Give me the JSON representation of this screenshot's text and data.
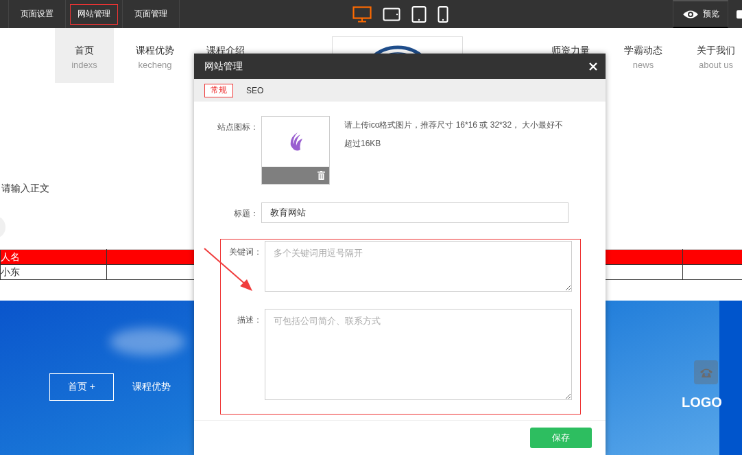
{
  "toolbar": {
    "tabs": [
      {
        "label": "页面设置",
        "selected": false
      },
      {
        "label": "网站管理",
        "selected": true
      },
      {
        "label": "页面管理",
        "selected": false
      }
    ],
    "devices": [
      {
        "kind": "desktop",
        "selected": true
      },
      {
        "kind": "tablet-landscape",
        "selected": false
      },
      {
        "kind": "tablet",
        "selected": false
      },
      {
        "kind": "phone",
        "selected": false
      }
    ],
    "preview_label": "预览"
  },
  "site_nav": {
    "items": [
      {
        "label": "首页",
        "sub": "indexs",
        "selected": true
      },
      {
        "label": "课程优势",
        "sub": "kecheng",
        "selected": false
      },
      {
        "label": "课程介绍",
        "selected": false
      }
    ],
    "right_items": [
      {
        "label": "师资力量",
        "selected": false
      },
      {
        "label": "学霸动态",
        "sub": "news",
        "selected": false
      },
      {
        "label": "关于我们",
        "sub": "about us",
        "selected": false
      }
    ]
  },
  "body_text": "请输入正文",
  "table": {
    "columns": [
      "人名"
    ],
    "rows": [
      [
        "小东"
      ]
    ]
  },
  "banner": {
    "nav": [
      {
        "label": "首页",
        "marker": "+",
        "boxed": true
      },
      {
        "label": "课程优势",
        "boxed": false
      }
    ],
    "logo": "LOGO"
  },
  "dialog": {
    "title": "网站管理",
    "tabs": [
      {
        "label": "常规",
        "selected": true
      },
      {
        "label": "SEO",
        "selected": false
      }
    ],
    "fields": [
      {
        "kind": "image",
        "label": "站点图标：",
        "hint": "请上传ico格式图片，推荐尺寸 16*16 或 32*32， 大小最好不超过16KB",
        "highlighted": false
      },
      {
        "kind": "text",
        "label": "标题：",
        "value": "教育网站",
        "highlighted": false
      },
      {
        "kind": "textarea",
        "label": "关键词：",
        "placeholder": "多个关键词用逗号隔开",
        "highlighted": true
      },
      {
        "kind": "textarea",
        "label": "描述：",
        "placeholder": "可包括公司简介、联系方式",
        "highlighted": true
      }
    ],
    "save_button": "保存"
  }
}
